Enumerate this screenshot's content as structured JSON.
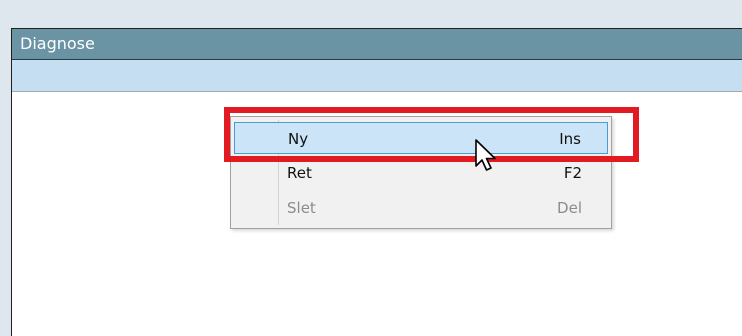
{
  "panel": {
    "title": "Diagnose"
  },
  "context_menu": {
    "items": [
      {
        "label": "Ny",
        "shortcut": "Ins",
        "state": "hover"
      },
      {
        "label": "Ret",
        "shortcut": "F2",
        "state": "enabled"
      },
      {
        "label": "Slet",
        "shortcut": "Del",
        "state": "disabled"
      }
    ]
  },
  "icons": {
    "cursor": "arrow-cursor-icon"
  },
  "colors": {
    "titlebar": "#6a93a4",
    "subbar": "#c5def1",
    "highlight": "#e21b23",
    "menu_hover_bg": "#cce4f7",
    "menu_hover_border": "#4a9bd6"
  }
}
